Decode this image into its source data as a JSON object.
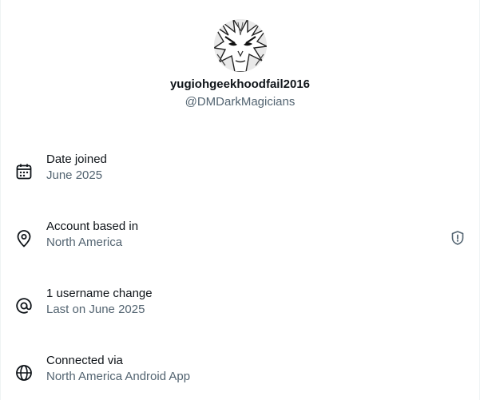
{
  "profile": {
    "display_name": "yugiohgeekhoodfail2016",
    "handle": "@DMDarkMagicians"
  },
  "details": [
    {
      "icon": "calendar-icon",
      "title": "Date joined",
      "value": "June 2025"
    },
    {
      "icon": "location-pin-icon",
      "title": "Account based in",
      "value": "North America"
    },
    {
      "icon": "at-sign-icon",
      "title": "1 username change",
      "value": "Last on June 2025"
    },
    {
      "icon": "globe-icon",
      "title": "Connected via",
      "value": "North America Android App"
    }
  ],
  "colors": {
    "primary_text": "#0f1419",
    "secondary_text": "#536471",
    "divider": "#eff3f4"
  }
}
